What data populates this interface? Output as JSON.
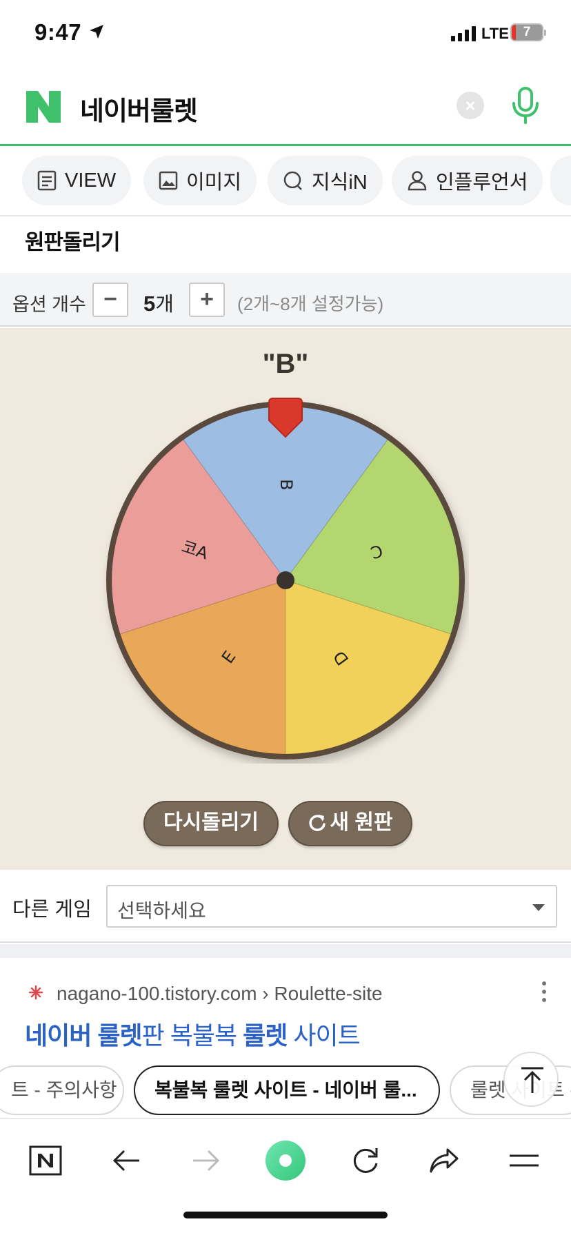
{
  "status_bar": {
    "time": "9:47",
    "network": "LTE",
    "battery": "7"
  },
  "search": {
    "query": "네이버룰렛",
    "clear_symbol": "×"
  },
  "tabs": [
    {
      "label": "VIEW",
      "icon": "document-icon"
    },
    {
      "label": "이미지",
      "icon": "image-icon"
    },
    {
      "label": "지식iN",
      "icon": "speech-bubble-icon"
    },
    {
      "label": "인플루언서",
      "icon": "person-icon"
    }
  ],
  "roulette": {
    "title": "원판돌리기",
    "option_count_label": "옵션 개수",
    "minus": "−",
    "plus": "+",
    "count_value": "5",
    "count_unit": "개",
    "range_hint": "(2개~8개 설정가능)",
    "result": "\"B\"",
    "segments": [
      {
        "label": "B",
        "color": "#9dbde3"
      },
      {
        "label": "C",
        "color": "#b3d66e"
      },
      {
        "label": "D",
        "color": "#f2d15a"
      },
      {
        "label": "E",
        "color": "#e9a857"
      },
      {
        "label": "코A",
        "color": "#eb9e99"
      }
    ],
    "respin_label": "다시돌리기",
    "new_wheel_label": "새 원판"
  },
  "other_game": {
    "label": "다른 게임",
    "select_value": "선택하세요"
  },
  "search_result": {
    "breadcrumb": "nagano-100.tistory.com › Roulette-site",
    "title_parts": [
      {
        "text": "네이버 룰렛",
        "bold": true
      },
      {
        "text": "판 복불복 ",
        "bold": false
      },
      {
        "text": "룰렛",
        "bold": true
      },
      {
        "text": " 사이트",
        "bold": false
      }
    ],
    "chips": [
      "트 - 주의사항",
      "복불복 룰렛 사이트 - 네이버 룰...",
      "룰렛 사이트 - "
    ]
  },
  "toolbar": {
    "icons": [
      "naver-home-icon",
      "back-arrow-icon",
      "forward-arrow-icon",
      "green-dot-icon",
      "refresh-icon",
      "share-icon",
      "menu-icon"
    ]
  }
}
